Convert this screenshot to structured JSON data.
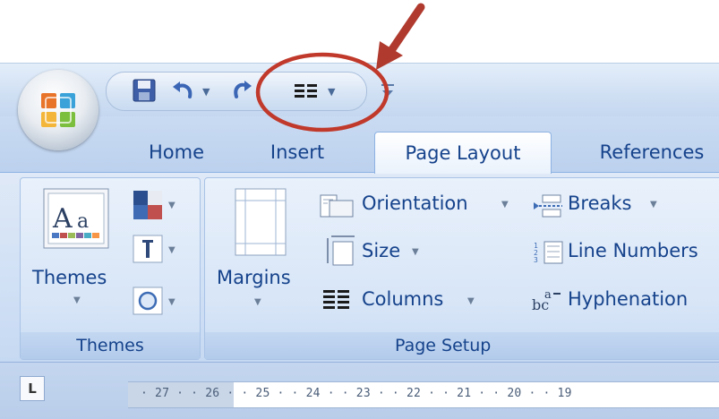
{
  "qat": {
    "items": [
      "save-icon",
      "undo-icon",
      "redo-icon",
      "columns-icon"
    ],
    "customize": "customize-icon"
  },
  "tabs": [
    {
      "label": "Home",
      "active": false
    },
    {
      "label": "Insert",
      "active": false
    },
    {
      "label": "Page Layout",
      "active": true
    },
    {
      "label": "References",
      "active": false
    }
  ],
  "themes_group": {
    "themes_label": "Themes",
    "group_label": "Themes"
  },
  "page_setup_group": {
    "margins_label": "Margins",
    "orientation_label": "Orientation",
    "size_label": "Size",
    "columns_label": "Columns",
    "breaks_label": "Breaks",
    "line_numbers_label": "Line Numbers",
    "hyphenation_label": "Hyphenation",
    "group_label": "Page Setup"
  },
  "ruler": {
    "tab_selector": "L",
    "text": "· 27 · · 26 · · 25 · · 24 · · 23 · · 22 · · 21 · · 20 · · 19"
  },
  "colors": {
    "ribbon_text": "#15428b",
    "annotation": "#c0392b"
  }
}
